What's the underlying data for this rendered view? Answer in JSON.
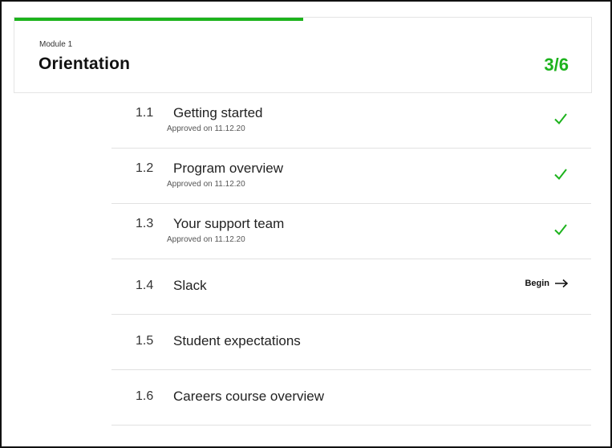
{
  "module": {
    "eyebrow": "Module 1",
    "title": "Orientation",
    "count": "3/6",
    "progress_fraction": 0.5,
    "accent_color": "#1db31d"
  },
  "lessons": [
    {
      "number": "1.1",
      "title": "Getting started",
      "status_text": "Approved on 11.12.20",
      "state": "approved"
    },
    {
      "number": "1.2",
      "title": "Program overview",
      "status_text": "Approved on 11.12.20",
      "state": "approved"
    },
    {
      "number": "1.3",
      "title": "Your support team",
      "status_text": "Approved on 11.12.20",
      "state": "approved"
    },
    {
      "number": "1.4",
      "title": "Slack",
      "action_label": "Begin",
      "state": "current"
    },
    {
      "number": "1.5",
      "title": "Student expectations",
      "state": "locked"
    },
    {
      "number": "1.6",
      "title": "Careers course overview",
      "state": "locked"
    }
  ],
  "icons": {
    "approved": "check-icon",
    "begin": "arrow-right-icon"
  }
}
